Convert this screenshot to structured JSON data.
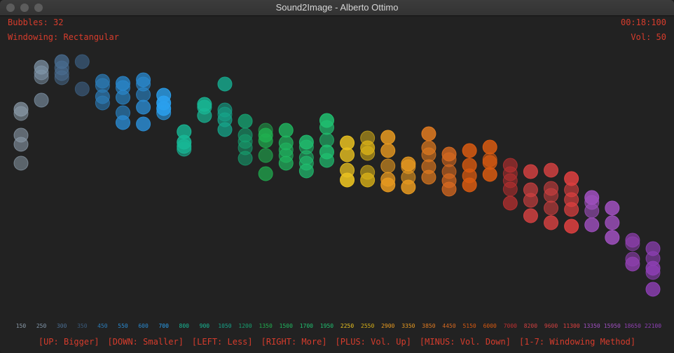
{
  "window": {
    "title": "Sound2Image - Alberto Ottimo"
  },
  "hud": {
    "bubbles": "Bubbles: 32",
    "windowing": "Windowing: Rectangular",
    "time": "00:18:100",
    "volume": "Vol: 50"
  },
  "colors": {
    "hud": "#d63c2c",
    "background": "#222222"
  },
  "bands": [
    {
      "label": "150",
      "color": "#8a9aa8",
      "b": [
        [
          156,
          0.7
        ],
        [
          162,
          0.55
        ],
        [
          193,
          0.6
        ],
        [
          206,
          0.6
        ],
        [
          233,
          0.55
        ]
      ]
    },
    {
      "label": "250",
      "color": "#8096aa",
      "b": [
        [
          96,
          0.7
        ],
        [
          104,
          0.55
        ],
        [
          110,
          0.5
        ],
        [
          143,
          0.6
        ]
      ]
    },
    {
      "label": "300",
      "color": "#4a6e92",
      "b": [
        [
          88,
          0.75
        ],
        [
          97,
          0.6
        ],
        [
          105,
          0.55
        ],
        [
          111,
          0.5
        ]
      ]
    },
    {
      "label": "350",
      "color": "#3a5a7a",
      "b": [
        [
          88,
          0.75
        ],
        [
          127,
          0.7
        ]
      ]
    },
    {
      "label": "450",
      "color": "#2c7cb8",
      "b": [
        [
          116,
          0.7
        ],
        [
          122,
          0.6
        ],
        [
          138,
          0.7
        ],
        [
          147,
          0.6
        ]
      ]
    },
    {
      "label": "550",
      "color": "#2a8ad0",
      "b": [
        [
          119,
          0.75
        ],
        [
          125,
          0.6
        ],
        [
          139,
          0.65
        ],
        [
          161,
          0.6
        ],
        [
          175,
          0.8
        ]
      ]
    },
    {
      "label": "600",
      "color": "#2a8ad0",
      "b": [
        [
          114,
          0.75
        ],
        [
          120,
          0.6
        ],
        [
          135,
          0.6
        ],
        [
          153,
          0.8
        ],
        [
          177,
          0.85
        ]
      ]
    },
    {
      "label": "700",
      "color": "#2aa0ee",
      "b": [
        [
          136,
          0.8
        ],
        [
          147,
          0.9
        ],
        [
          155,
          0.85
        ],
        [
          161,
          0.6
        ]
      ]
    },
    {
      "label": "800",
      "color": "#18b896",
      "b": [
        [
          188,
          0.8
        ],
        [
          203,
          0.85
        ],
        [
          209,
          0.7
        ],
        [
          213,
          0.6
        ]
      ]
    },
    {
      "label": "900",
      "color": "#18b896",
      "b": [
        [
          149,
          0.8
        ],
        [
          153,
          0.7
        ],
        [
          165,
          0.7
        ]
      ]
    },
    {
      "label": "1050",
      "color": "#16a48a",
      "b": [
        [
          120,
          0.85
        ],
        [
          157,
          0.6
        ],
        [
          163,
          0.55
        ],
        [
          171,
          0.7
        ],
        [
          185,
          0.75
        ]
      ]
    },
    {
      "label": "1200",
      "color": "#16a070",
      "b": [
        [
          173,
          0.8
        ],
        [
          193,
          0.6
        ],
        [
          202,
          0.55
        ],
        [
          211,
          0.55
        ],
        [
          226,
          0.6
        ]
      ]
    },
    {
      "label": "1350",
      "color": "#20b050",
      "b": [
        [
          186,
          0.5
        ],
        [
          193,
          0.8
        ],
        [
          201,
          0.7
        ],
        [
          222,
          0.6
        ],
        [
          248,
          0.7
        ]
      ]
    },
    {
      "label": "1500",
      "color": "#20b860",
      "b": [
        [
          186,
          0.8
        ],
        [
          204,
          0.7
        ],
        [
          214,
          0.6
        ],
        [
          222,
          0.6
        ],
        [
          233,
          0.7
        ]
      ]
    },
    {
      "label": "1700",
      "color": "#20c070",
      "b": [
        [
          203,
          0.8
        ],
        [
          210,
          0.55
        ],
        [
          225,
          0.55
        ],
        [
          233,
          0.6
        ],
        [
          244,
          0.7
        ]
      ]
    },
    {
      "label": "1950",
      "color": "#20c070",
      "b": [
        [
          172,
          0.85
        ],
        [
          182,
          0.7
        ],
        [
          200,
          0.6
        ],
        [
          217,
          0.8
        ],
        [
          229,
          0.7
        ]
      ]
    },
    {
      "label": "2250",
      "color": "#e8c020",
      "b": [
        [
          204,
          0.85
        ],
        [
          221,
          0.8
        ],
        [
          243,
          0.75
        ],
        [
          257,
          0.9
        ]
      ]
    },
    {
      "label": "2550",
      "color": "#d8b018",
      "b": [
        [
          197,
          0.55
        ],
        [
          211,
          0.8
        ],
        [
          219,
          0.6
        ],
        [
          246,
          0.6
        ],
        [
          257,
          0.8
        ]
      ]
    },
    {
      "label": "2900",
      "color": "#e89a20",
      "b": [
        [
          196,
          0.85
        ],
        [
          215,
          0.8
        ],
        [
          237,
          0.6
        ],
        [
          256,
          0.75
        ],
        [
          264,
          0.85
        ]
      ]
    },
    {
      "label": "3350",
      "color": "#e89a20",
      "b": [
        [
          234,
          0.8
        ],
        [
          238,
          0.6
        ],
        [
          253,
          0.6
        ],
        [
          267,
          0.85
        ]
      ]
    },
    {
      "label": "3850",
      "color": "#e07a20",
      "b": [
        [
          191,
          0.85
        ],
        [
          211,
          0.7
        ],
        [
          221,
          0.6
        ],
        [
          238,
          0.65
        ],
        [
          253,
          0.7
        ]
      ]
    },
    {
      "label": "4450",
      "color": "#d86a20",
      "b": [
        [
          220,
          0.8
        ],
        [
          228,
          0.6
        ],
        [
          245,
          0.6
        ],
        [
          258,
          0.7
        ],
        [
          270,
          0.75
        ]
      ]
    },
    {
      "label": "5150",
      "color": "#d85a10",
      "b": [
        [
          215,
          0.85
        ],
        [
          236,
          0.8
        ],
        [
          251,
          0.75
        ],
        [
          264,
          0.85
        ]
      ]
    },
    {
      "label": "6000",
      "color": "#d85a10",
      "b": [
        [
          210,
          0.85
        ],
        [
          232,
          0.7
        ],
        [
          249,
          0.85
        ],
        [
          228,
          0.6
        ]
      ]
    },
    {
      "label": "7000",
      "color": "#c03030",
      "b": [
        [
          236,
          0.6
        ],
        [
          248,
          0.5
        ],
        [
          270,
          0.55
        ],
        [
          290,
          0.7
        ],
        [
          258,
          0.5
        ]
      ]
    },
    {
      "label": "8200",
      "color": "#d04040",
      "b": [
        [
          245,
          0.85
        ],
        [
          271,
          0.7
        ],
        [
          286,
          0.65
        ],
        [
          308,
          0.85
        ]
      ]
    },
    {
      "label": "9600",
      "color": "#d04040",
      "b": [
        [
          243,
          0.85
        ],
        [
          269,
          0.6
        ],
        [
          279,
          0.55
        ],
        [
          297,
          0.6
        ],
        [
          318,
          0.85
        ]
      ]
    },
    {
      "label": "11300",
      "color": "#e04040",
      "b": [
        [
          255,
          0.85
        ],
        [
          271,
          0.6
        ],
        [
          285,
          0.65
        ],
        [
          299,
          0.7
        ],
        [
          323,
          0.85
        ]
      ]
    },
    {
      "label": "13350",
      "color": "#a050c0",
      "b": [
        [
          282,
          0.85
        ],
        [
          289,
          0.6
        ],
        [
          301,
          0.6
        ],
        [
          321,
          0.8
        ]
      ]
    },
    {
      "label": "15950",
      "color": "#a050c0",
      "b": [
        [
          297,
          0.85
        ],
        [
          318,
          0.8
        ],
        [
          339,
          0.85
        ]
      ]
    },
    {
      "label": "18650",
      "color": "#9040b0",
      "b": [
        [
          343,
          0.7
        ],
        [
          348,
          0.55
        ],
        [
          370,
          0.6
        ],
        [
          377,
          0.8
        ]
      ]
    },
    {
      "label": "22100",
      "color": "#9040b8",
      "b": [
        [
          355,
          0.7
        ],
        [
          369,
          0.6
        ],
        [
          383,
          0.8
        ],
        [
          389,
          0.6
        ],
        [
          413,
          0.8
        ]
      ]
    }
  ],
  "footer": [
    "[UP: Bigger]",
    "[DOWN: Smaller]",
    "[LEFT: Less]",
    "[RIGHT: More]",
    "[PLUS: Vol. Up]",
    "[MINUS: Vol. Down]",
    "[1-7: Windowing Method]"
  ]
}
